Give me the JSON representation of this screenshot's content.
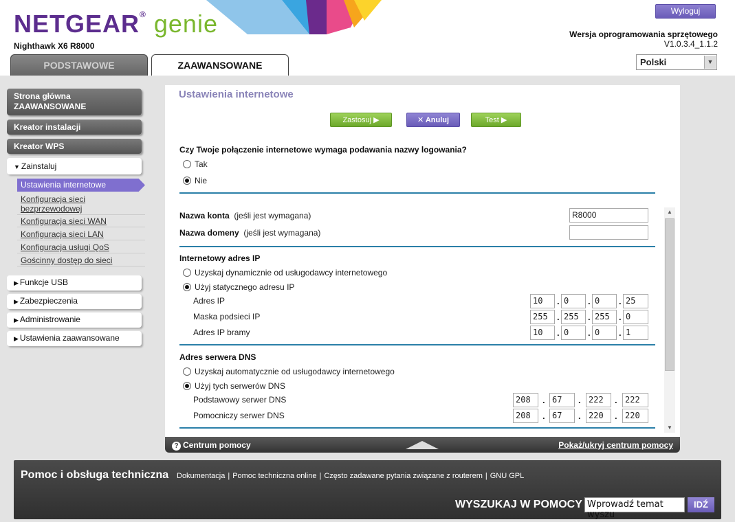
{
  "header": {
    "brand": "NETGEAR",
    "genie": "genie",
    "registered": "®",
    "model": "Nighthawk X6 R8000",
    "logout_label": "Wyloguj",
    "firmware_label": "Wersja oprogramowania sprzętowego",
    "firmware_version": "V1.0.3.4_1.1.2",
    "language": "Polski"
  },
  "tabs": [
    {
      "label": "PODSTAWOWE",
      "active": false
    },
    {
      "label": "ZAAWANSOWANE",
      "active": true
    }
  ],
  "sidebar": {
    "home_line1": "Strona główna",
    "home_line2": "ZAAWANSOWANE",
    "setup_wizard": "Kreator instalacji",
    "wps_wizard": "Kreator WPS",
    "install": "Zainstaluj",
    "sub_items": [
      "Ustawienia internetowe",
      "Konfiguracja sieci",
      "bezprzewodowej",
      "Konfiguracja sieci WAN",
      "Konfiguracja sieci LAN",
      "Konfiguracja usługi QoS",
      "Gościnny dostęp do sieci"
    ],
    "usb": "Funkcje USB",
    "security": "Zabezpieczenia",
    "admin": "Administrowanie",
    "advanced": "Ustawienia zaawansowane"
  },
  "panel": {
    "title": "Ustawienia internetowe",
    "apply": "Zastosuj ▶",
    "cancel": "✕ Anuluj",
    "test": "Test ▶",
    "login_question": "Czy Twoje połączenie internetowe wymaga podawania nazwy logowania?",
    "yes": "Tak",
    "no": "Nie",
    "account_name": "Nazwa konta",
    "account_hint": "(jeśli jest wymagana)",
    "account_value": "R8000",
    "domain_name": "Nazwa domeny",
    "domain_hint": "(jeśli jest wymagana)",
    "domain_value": "",
    "ip_section": "Internetowy adres IP",
    "ip_dynamic": "Uzyskaj dynamicznie od usługodawcy internetowego",
    "ip_static": "Użyj statycznego adresu IP",
    "ip_address_label": "Adres IP",
    "ip_address": [
      "10",
      "0",
      "0",
      "25"
    ],
    "subnet_label": "Maska podsieci IP",
    "subnet": [
      "255",
      "255",
      "255",
      "0"
    ],
    "gateway_label": "Adres IP bramy",
    "gateway": [
      "10",
      "0",
      "0",
      "1"
    ],
    "dns_section": "Adres serwera DNS",
    "dns_auto": "Uzyskaj automatycznie od usługodawcy internetowego",
    "dns_manual": "Użyj tych serwerów DNS",
    "dns_primary_label": "Podstawowy serwer DNS",
    "dns_primary": [
      "208",
      "67",
      "222",
      "222"
    ],
    "dns_secondary_label": "Pomocniczy serwer DNS",
    "dns_secondary": [
      "208",
      "67",
      "220",
      "220"
    ]
  },
  "helpbar": {
    "help_center": "Centrum pomocy",
    "toggle": "Pokaż/ukryj centrum pomocy"
  },
  "footer": {
    "title": "Pomoc i obsługa techniczna",
    "links": [
      "Dokumentacja",
      "Pomoc techniczna online",
      "Często zadawane pytania związane z routerem",
      "GNU GPL"
    ],
    "search_label": "WYSZUKAJ W POMOCY",
    "search_placeholder": "Wprowadź temat wyszu",
    "search_button": "IDŹ"
  },
  "colors": {
    "brand_purple": "#5c2d8e",
    "genie_green": "#7ab72e",
    "accent_line": "#2a7fa8",
    "active_nav": "#7f6fcf"
  }
}
